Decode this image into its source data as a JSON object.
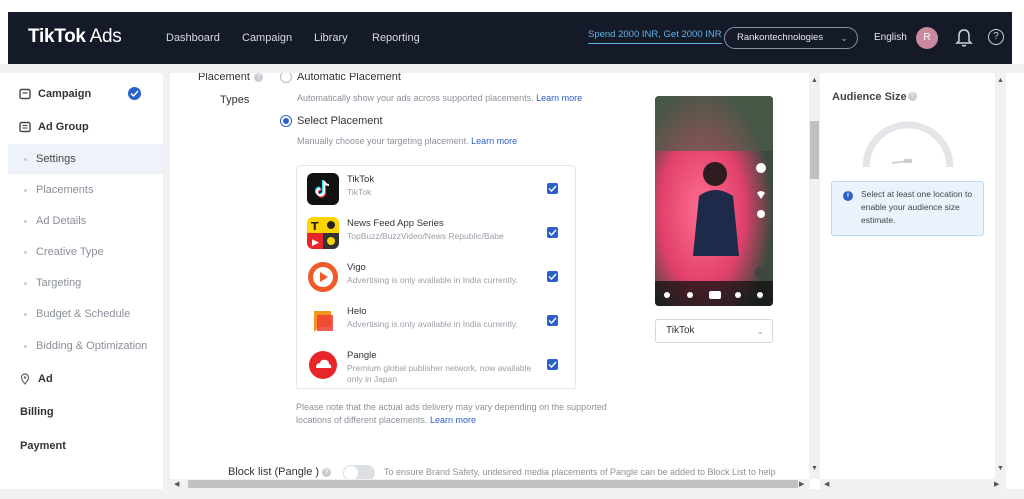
{
  "header": {
    "logo_main": "TikTok",
    "logo_suffix": " Ads",
    "nav": [
      "Dashboard",
      "Campaign",
      "Library",
      "Reporting"
    ],
    "promo": "Spend 2000 INR, Get 2000 INR",
    "account": "Rankontechnologies",
    "language": "English",
    "avatar_initial": "R",
    "help_glyph": "?"
  },
  "sidebar": {
    "items": [
      {
        "label": "Campaign",
        "kind": "main",
        "completed": true
      },
      {
        "label": "Ad Group",
        "kind": "main"
      },
      {
        "label": "Settings",
        "kind": "sub",
        "active": true
      },
      {
        "label": "Placements",
        "kind": "sub"
      },
      {
        "label": "Ad Details",
        "kind": "sub"
      },
      {
        "label": "Creative Type",
        "kind": "sub"
      },
      {
        "label": "Targeting",
        "kind": "sub"
      },
      {
        "label": "Budget & Schedule",
        "kind": "sub"
      },
      {
        "label": "Bidding & Optimization",
        "kind": "sub"
      },
      {
        "label": "Ad",
        "kind": "main"
      },
      {
        "label": "Billing",
        "kind": "plain"
      },
      {
        "label": "Payment",
        "kind": "plain"
      }
    ]
  },
  "placement": {
    "label_line1": "Placement",
    "label_line2": "Types",
    "auto_option": "Automatic Placement",
    "auto_hint": "Automatically show your ads across supported placements.",
    "select_option": "Select Placement",
    "select_hint": "Manually choose your targeting placement.",
    "learn_more": "Learn more",
    "items": [
      {
        "name": "TikTok",
        "desc": "TikTok",
        "checked": true
      },
      {
        "name": "News Feed App Series",
        "desc": "TopBuzz/BuzzVideo/News Republic/Babe",
        "checked": true
      },
      {
        "name": "Vigo",
        "desc": "Advertising is only available in India currently.",
        "checked": true
      },
      {
        "name": "Helo",
        "desc": "Advertising is only available in India currently.",
        "checked": true
      },
      {
        "name": "Pangle",
        "desc": "Premium global publisher network, now available only in Japan",
        "checked": true
      }
    ],
    "note": "Please note that the actual ads delivery may vary depending on the supported locations of different placements.",
    "preview_select": "TikTok",
    "block_label": "Block list (Pangle )",
    "block_text": "To ensure Brand Safety, undesired media placements of Pangle can be added to Block List to help"
  },
  "audience": {
    "title": "Audience Size",
    "info": "Select at least one location to enable your audience size estimate.",
    "info_glyph": "i"
  },
  "colors": {
    "header_bg": "#151a28",
    "accent": "#2a60c8",
    "promo": "#5fb3e6"
  }
}
